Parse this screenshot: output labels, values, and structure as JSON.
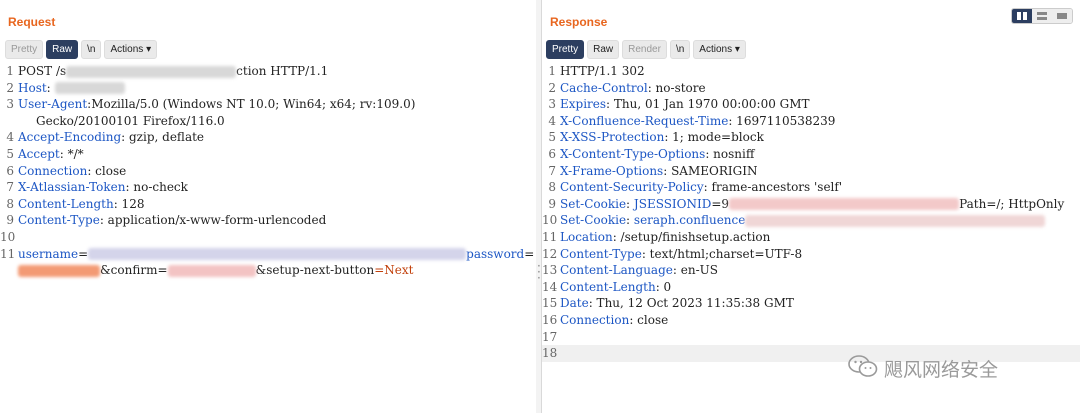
{
  "request": {
    "title": "Request",
    "tabs": [
      "Pretty",
      "Raw",
      "\\n"
    ],
    "actions_label": "Actions",
    "lines": [
      {
        "n": "1",
        "parts": [
          [
            "t",
            "POST /s"
          ],
          [
            "b",
            "#d8d8d8",
            170
          ],
          [
            "t",
            "ction HTTP/1.1"
          ]
        ]
      },
      {
        "n": "2",
        "parts": [
          [
            "k",
            "Host"
          ],
          [
            "t",
            ": "
          ],
          [
            "b",
            "#d8d8d8",
            70
          ]
        ]
      },
      {
        "n": "3",
        "parts": [
          [
            "k",
            "User-Agent"
          ],
          [
            "t",
            ":Mozilla/5.0 (Windows NT 10.0; Win64; x64; rv:109.0)"
          ]
        ]
      },
      {
        "n": "",
        "parts": [
          [
            "c",
            "Gecko/20100101 Firefox/116.0"
          ]
        ]
      },
      {
        "n": "4",
        "parts": [
          [
            "k",
            "Accept-Encoding"
          ],
          [
            "t",
            ": gzip, deflate"
          ]
        ]
      },
      {
        "n": "5",
        "parts": [
          [
            "k",
            "Accept"
          ],
          [
            "t",
            ": */*"
          ]
        ]
      },
      {
        "n": "6",
        "parts": [
          [
            "k",
            "Connection"
          ],
          [
            "t",
            ": close"
          ]
        ]
      },
      {
        "n": "7",
        "parts": [
          [
            "k",
            "X-Atlassian-Token"
          ],
          [
            "t",
            ": no-check"
          ]
        ]
      },
      {
        "n": "8",
        "parts": [
          [
            "k",
            "Content-Length"
          ],
          [
            "t",
            ": 128"
          ]
        ]
      },
      {
        "n": "9",
        "parts": [
          [
            "k",
            "Content-Type"
          ],
          [
            "t",
            ": application/x-www-form-urlencoded"
          ]
        ]
      },
      {
        "n": "10",
        "parts": []
      },
      {
        "n": "11",
        "parts": [
          [
            "k",
            "username"
          ],
          [
            "t",
            "="
          ],
          [
            "b",
            "#d4d4ea",
            378
          ],
          [
            "k",
            "password"
          ],
          [
            "t",
            "="
          ]
        ]
      },
      {
        "n": "",
        "parts": [
          [
            "b",
            "#f39a74",
            82
          ],
          [
            "t",
            "&confirm="
          ],
          [
            "b",
            "#f3c3c3",
            88
          ],
          [
            "t",
            "&setup-next-button"
          ],
          [
            "v",
            "=Next"
          ]
        ]
      }
    ]
  },
  "response": {
    "title": "Response",
    "tabs": [
      "Pretty",
      "Raw",
      "Render",
      "\\n"
    ],
    "actions_label": "Actions",
    "lines": [
      {
        "n": "1",
        "parts": [
          [
            "t",
            "HTTP/1.1 302"
          ]
        ]
      },
      {
        "n": "2",
        "parts": [
          [
            "k",
            "Cache-Control"
          ],
          [
            "t",
            ": no-store"
          ]
        ]
      },
      {
        "n": "3",
        "parts": [
          [
            "k",
            "Expires"
          ],
          [
            "t",
            ": Thu, 01 Jan 1970 00:00:00 GMT"
          ]
        ]
      },
      {
        "n": "4",
        "parts": [
          [
            "k",
            "X-Confluence-Request-Time"
          ],
          [
            "t",
            ": 1697110538239"
          ]
        ]
      },
      {
        "n": "5",
        "parts": [
          [
            "k",
            "X-XSS-Protection"
          ],
          [
            "t",
            ": 1; mode=block"
          ]
        ]
      },
      {
        "n": "6",
        "parts": [
          [
            "k",
            "X-Content-Type-Options"
          ],
          [
            "t",
            ": nosniff"
          ]
        ]
      },
      {
        "n": "7",
        "parts": [
          [
            "k",
            "X-Frame-Options"
          ],
          [
            "t",
            ": SAMEORIGIN"
          ]
        ]
      },
      {
        "n": "8",
        "parts": [
          [
            "k",
            "Content-Security-Policy"
          ],
          [
            "t",
            ": frame-ancestors 'self'"
          ]
        ]
      },
      {
        "n": "9",
        "parts": [
          [
            "k",
            "Set-Cookie"
          ],
          [
            "t",
            ": "
          ],
          [
            "k",
            "JSESSIONID"
          ],
          [
            "t",
            "=9"
          ],
          [
            "b",
            "#f3c9c9",
            230
          ],
          [
            "t",
            "Path=/; HttpOnly"
          ]
        ]
      },
      {
        "n": "10",
        "parts": [
          [
            "k",
            "Set-Cookie"
          ],
          [
            "t",
            ": "
          ],
          [
            "k",
            "seraph.confluence"
          ],
          [
            "b",
            "#f0d6d6",
            300
          ]
        ]
      },
      {
        "n": "11",
        "parts": [
          [
            "k",
            "Location"
          ],
          [
            "t",
            ": /setup/finishsetup.action"
          ]
        ]
      },
      {
        "n": "12",
        "parts": [
          [
            "k",
            "Content-Type"
          ],
          [
            "t",
            ": text/html;charset=UTF-8"
          ]
        ]
      },
      {
        "n": "13",
        "parts": [
          [
            "k",
            "Content-Language"
          ],
          [
            "t",
            ": en-US"
          ]
        ]
      },
      {
        "n": "14",
        "parts": [
          [
            "k",
            "Content-Length"
          ],
          [
            "t",
            ": 0"
          ]
        ]
      },
      {
        "n": "15",
        "parts": [
          [
            "k",
            "Date"
          ],
          [
            "t",
            ": Thu, 12 Oct 2023 11:35:38 GMT"
          ]
        ]
      },
      {
        "n": "16",
        "parts": [
          [
            "k",
            "Connection"
          ],
          [
            "t",
            ": close"
          ]
        ]
      },
      {
        "n": "17",
        "parts": []
      },
      {
        "n": "18",
        "parts": []
      }
    ]
  },
  "watermark": "飓风网络安全",
  "colors": {
    "accent": "#e8661f",
    "header_key": "#1c56c4",
    "active_tab": "#2c3e60"
  }
}
